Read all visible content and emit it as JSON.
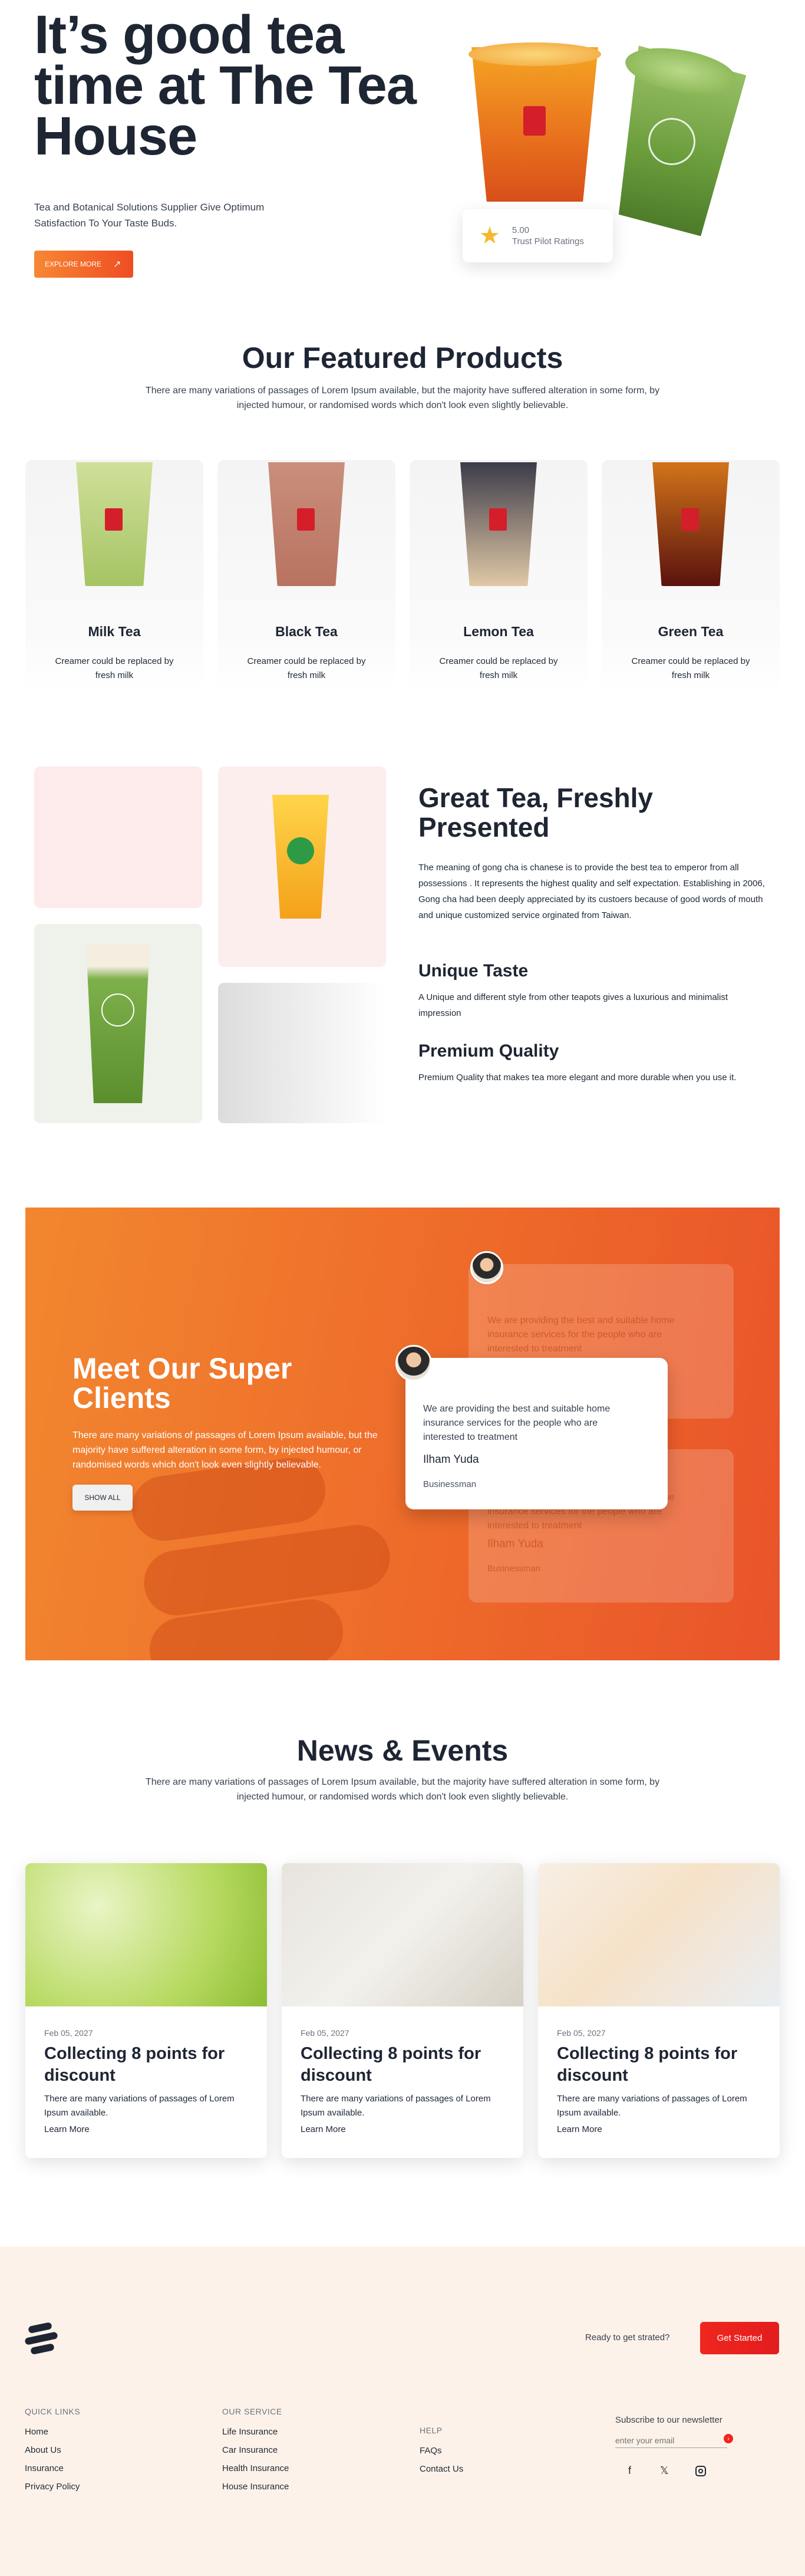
{
  "hero": {
    "title": "It’s good tea time at The Tea House",
    "subtitle": "Tea and Botanical Solutions Supplier Give Optimum Satisfaction To Your Taste Buds.",
    "cta_label": "EXPLORE MORE",
    "rating_value": "5.00",
    "rating_label": "Trust Pilot Ratings"
  },
  "featured": {
    "title": "Our Featured Products",
    "description": "There are many variations of passages of Lorem Ipsum available, but the majority have suffered alteration in some form, by injected humour, or randomised words which don't look even slightly believable.",
    "products": [
      {
        "name": "Milk Tea",
        "desc": "Creamer could be replaced by fresh milk",
        "top": "#cfe09a",
        "bottom": "#a6c464"
      },
      {
        "name": "Black Tea",
        "desc": "Creamer could be replaced by fresh milk",
        "top": "#c98f7c",
        "bottom": "#b87360"
      },
      {
        "name": "Lemon Tea",
        "desc": "Creamer could be replaced by fresh milk",
        "top": "#3c3b4a",
        "bottom": "#e1c9a6"
      },
      {
        "name": "Green Tea",
        "desc": "Creamer could be replaced by fresh milk",
        "top": "#d1741a",
        "bottom": "#5a120e"
      }
    ]
  },
  "great_tea": {
    "title": "Great Tea, Freshly Presented",
    "body": "The meaning of gong cha is chanese is to provide the best tea to emperor from all possessions . It represents the highest quality and self expectation. Establishing in 2006, Gong cha had been deeply appreciated by its custoers because of good words of mouth and unique customized service orginated from Taiwan.",
    "unique_title": "Unique Taste",
    "unique_body": "A Unique and different style from other teapots gives a luxurious and minimalist impression",
    "premium_title": "Premium Quality",
    "premium_body": "Premium Quality that makes tea more elegant and more durable when you use it."
  },
  "clients": {
    "title": "Meet Our Super Clients",
    "description": "There are many variations of passages of Lorem Ipsum available, but the majority have suffered alteration in some form, by injected humour, or randomised words which don't look even slightly believable.",
    "button": "SHOW ALL",
    "quote": "We are providing the best and suitable home insurance services for the people who are interested to treatment",
    "name": "Ilham Yuda",
    "role": "Businessman"
  },
  "news": {
    "title": "News & Events",
    "description": "There are many variations of passages of Lorem Ipsum available, but the majority have suffered alteration in some form, by injected humour, or randomised words which don't look even slightly believable.",
    "items": [
      {
        "date": "Feb 05, 2027",
        "title": "Collecting 8 points for discount",
        "desc": "There are many variations of passages of Lorem Ipsum available.",
        "more": "Learn More"
      },
      {
        "date": "Feb 05, 2027",
        "title": "Collecting 8 points for discount",
        "desc": "There are many variations of passages of Lorem Ipsum available.",
        "more": "Learn More"
      },
      {
        "date": "Feb 05, 2027",
        "title": "Collecting 8 points for discount",
        "desc": "There are many variations of passages of Lorem Ipsum available.",
        "more": "Learn More"
      }
    ]
  },
  "footer": {
    "ready_text": "Ready to get strated?",
    "start_button": "Get Started",
    "col1": {
      "title": "QUICK LINKS",
      "links": [
        "Home",
        "About Us",
        "Insurance",
        "Privacy Policy"
      ]
    },
    "col2": {
      "title": "OUR SERVICE",
      "links": [
        "Life Insurance",
        "Car Insurance",
        "Health Insurance",
        "House Insurance"
      ]
    },
    "col3": {
      "title": "HELP",
      "links": [
        "FAQs",
        "Contact Us"
      ]
    },
    "newsletter_label": "Subscribe to our newsletter",
    "email_placeholder": "enter your email",
    "icons": [
      "facebook-icon",
      "twitter-icon",
      "instagram-icon"
    ]
  }
}
